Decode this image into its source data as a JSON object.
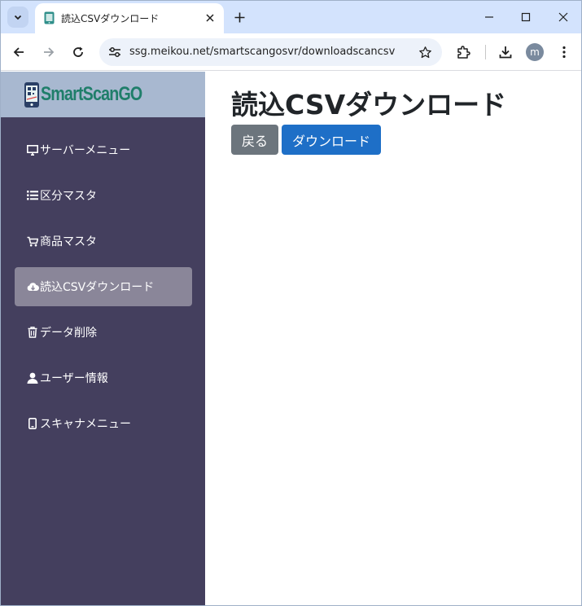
{
  "browser": {
    "tab": {
      "title": "読込CSVダウンロード",
      "favicon": "phone-app-icon"
    },
    "address_bar": {
      "url": "ssg.meikou.net/smartscangosvr/downloadscancsv"
    },
    "profile_initial": "m",
    "icons": {
      "tab_search": "chevron-down-icon",
      "tab_close": "close-icon",
      "new_tab": "plus-icon",
      "minimize": "minimize-icon",
      "maximize": "maximize-icon",
      "close_window": "close-icon",
      "back": "arrow-left-icon",
      "forward": "arrow-right-icon",
      "reload": "reload-icon",
      "site_info": "tune-icon",
      "bookmark": "star-icon",
      "extensions": "puzzle-icon",
      "downloads": "download-icon",
      "menu": "kebab-menu-icon"
    }
  },
  "sidebar": {
    "brand": "SmartScanGO",
    "items": [
      {
        "label": "サーバーメニュー",
        "icon": "desktop-icon",
        "active": false
      },
      {
        "label": "区分マスタ",
        "icon": "list-icon",
        "active": false
      },
      {
        "label": "商品マスタ",
        "icon": "cart-icon",
        "active": false
      },
      {
        "label": "読込CSVダウンロード",
        "icon": "cloud-download-icon",
        "active": true
      },
      {
        "label": "データ削除",
        "icon": "trash-icon",
        "active": false
      },
      {
        "label": "ユーザー情報",
        "icon": "user-icon",
        "active": false
      },
      {
        "label": "スキャナメニュー",
        "icon": "mobile-icon",
        "active": false
      }
    ]
  },
  "main": {
    "title": "読込CSVダウンロード",
    "buttons": {
      "back": "戻る",
      "download": "ダウンロード"
    }
  },
  "colors": {
    "sidebar_bg": "#443f5e",
    "sidebar_active": "#8a8699",
    "brand_bg": "#a8b8d0",
    "btn_secondary": "#6c757d",
    "btn_primary": "#1e6fc7",
    "tabstrip": "#d3e3fd"
  }
}
